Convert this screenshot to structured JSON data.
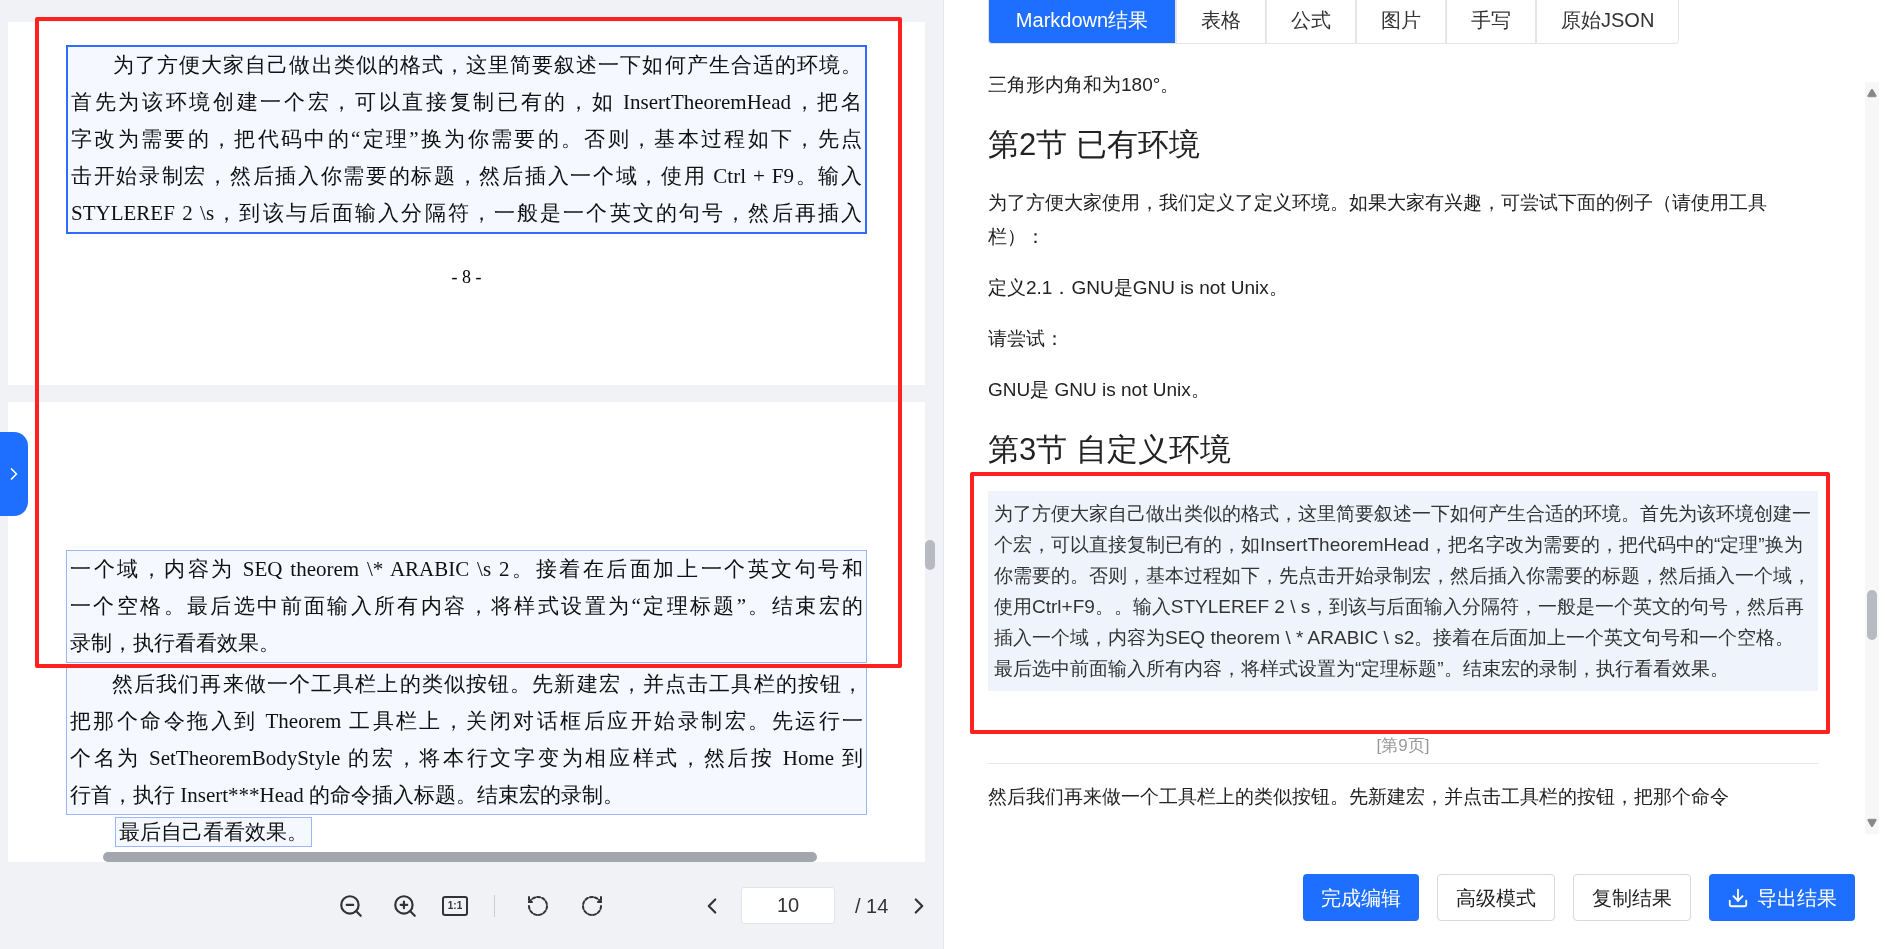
{
  "left_panel": {
    "pages": [
      {
        "blocks": [
          {
            "kind": "paragraph",
            "selected": true,
            "indent": true,
            "lines": [
              "为了方便大家自己做出类似的格式，这里简要叙述一下如何产生合适的环境。",
              "首先为该环境创建一个宏，可以直接复制已有的，如 InsertTheoremHead，把名",
              "字改为需要的，把代码中的“定理”换为你需要的。否则，基本过程如下，先点",
              "击开始录制宏，然后插入你需要的标题，然后插入一个域，使用 Ctrl + F9。输入",
              "STYLEREF 2 \\s，到该与后面输入分隔符，一般是一个英文的句号，然后再插入"
            ]
          }
        ],
        "page_number": "- 8 -"
      },
      {
        "blocks": [
          {
            "kind": "paragraph",
            "selected": false,
            "indent": false,
            "lines": [
              "一个域，内容为 SEQ theorem \\* ARABIC \\s 2。接着在后面加上一个英文句号和",
              "一个空格。最后选中前面输入所有内容，将样式设置为“定理标题”。结束宏的",
              "录制，执行看看效果。"
            ]
          },
          {
            "kind": "paragraph",
            "selected": false,
            "indent": true,
            "lines": [
              "然后我们再来做一个工具栏上的类似按钮。先新建宏，并点击工具栏的按钮，",
              "把那个命令拖入到 Theorem 工具栏上，关闭对话框后应开始录制宏。先运行一",
              "个名为 SetTheoremBodyStyle 的宏，将本行文字变为相应样式，然后按 Home 到",
              "行首，执行 Insert***Head 的命令插入标题。结束宏的录制。"
            ]
          },
          {
            "kind": "short",
            "selected": false,
            "indent": false,
            "lines": [
              "最后自己看看效果。"
            ]
          }
        ]
      }
    ]
  },
  "toolbar": {
    "actual_size": "1:1",
    "page_input": "10",
    "page_total": "/ 14"
  },
  "right_panel": {
    "tabs": [
      {
        "label": "Markdown结果",
        "selected": true
      },
      {
        "label": "表格",
        "selected": false
      },
      {
        "label": "公式",
        "selected": false
      },
      {
        "label": "图片",
        "selected": false
      },
      {
        "label": "手写",
        "selected": false
      },
      {
        "label": "原始JSON",
        "selected": false
      }
    ],
    "content": [
      {
        "kind": "paragraph",
        "text": "三角形内角和为180°。"
      },
      {
        "kind": "heading",
        "text": "第2节 已有环境"
      },
      {
        "kind": "paragraph",
        "text": "为了方便大家使用，我们定义了定义环境。如果大家有兴趣，可尝试下面的例子（请使用工具栏）："
      },
      {
        "kind": "paragraph",
        "text": "定义2.1．GNU是GNU is not Unix。"
      },
      {
        "kind": "paragraph",
        "text": "请尝试："
      },
      {
        "kind": "paragraph",
        "text": "GNU是 GNU is not Unix。"
      },
      {
        "kind": "heading",
        "text": "第3节 自定义环境"
      },
      {
        "kind": "highlight",
        "text": "为了方便大家自己做出类似的格式，这里简要叙述一下如何产生合适的环境。首先为该环境创建一个宏，可以直接复制已有的，如InsertTheoremHead，把名字改为需要的，把代码中的“定理”换为你需要的。否则，基本过程如下，先点击开始录制宏，然后插入你需要的标题，然后插入一个域，使用Ctrl+F9。。输入STYLEREF 2 \\ s，到该与后面输入分隔符，一般是一个英文的句号，然后再插入一个域，内容为SEQ theorem \\ * ARABIC  \\ s2。接着在后面加上一个英文句号和一个空格。最后选中前面输入所有内容，将样式设置为“定理标题”。结束宏的录制，执行看看效果。"
      },
      {
        "kind": "page_marker",
        "text": "[第9页]"
      },
      {
        "kind": "cut",
        "text": "然后我们再来做一个工具栏上的类似按钮。先新建宏，并点击工具栏的按钮，把那个命令"
      }
    ],
    "buttons": [
      {
        "label": "完成编辑",
        "kind": "primary"
      },
      {
        "label": "高级模式",
        "kind": "secondary"
      },
      {
        "label": "复制结果",
        "kind": "secondary"
      },
      {
        "label": "导出结果",
        "kind": "download"
      }
    ]
  }
}
